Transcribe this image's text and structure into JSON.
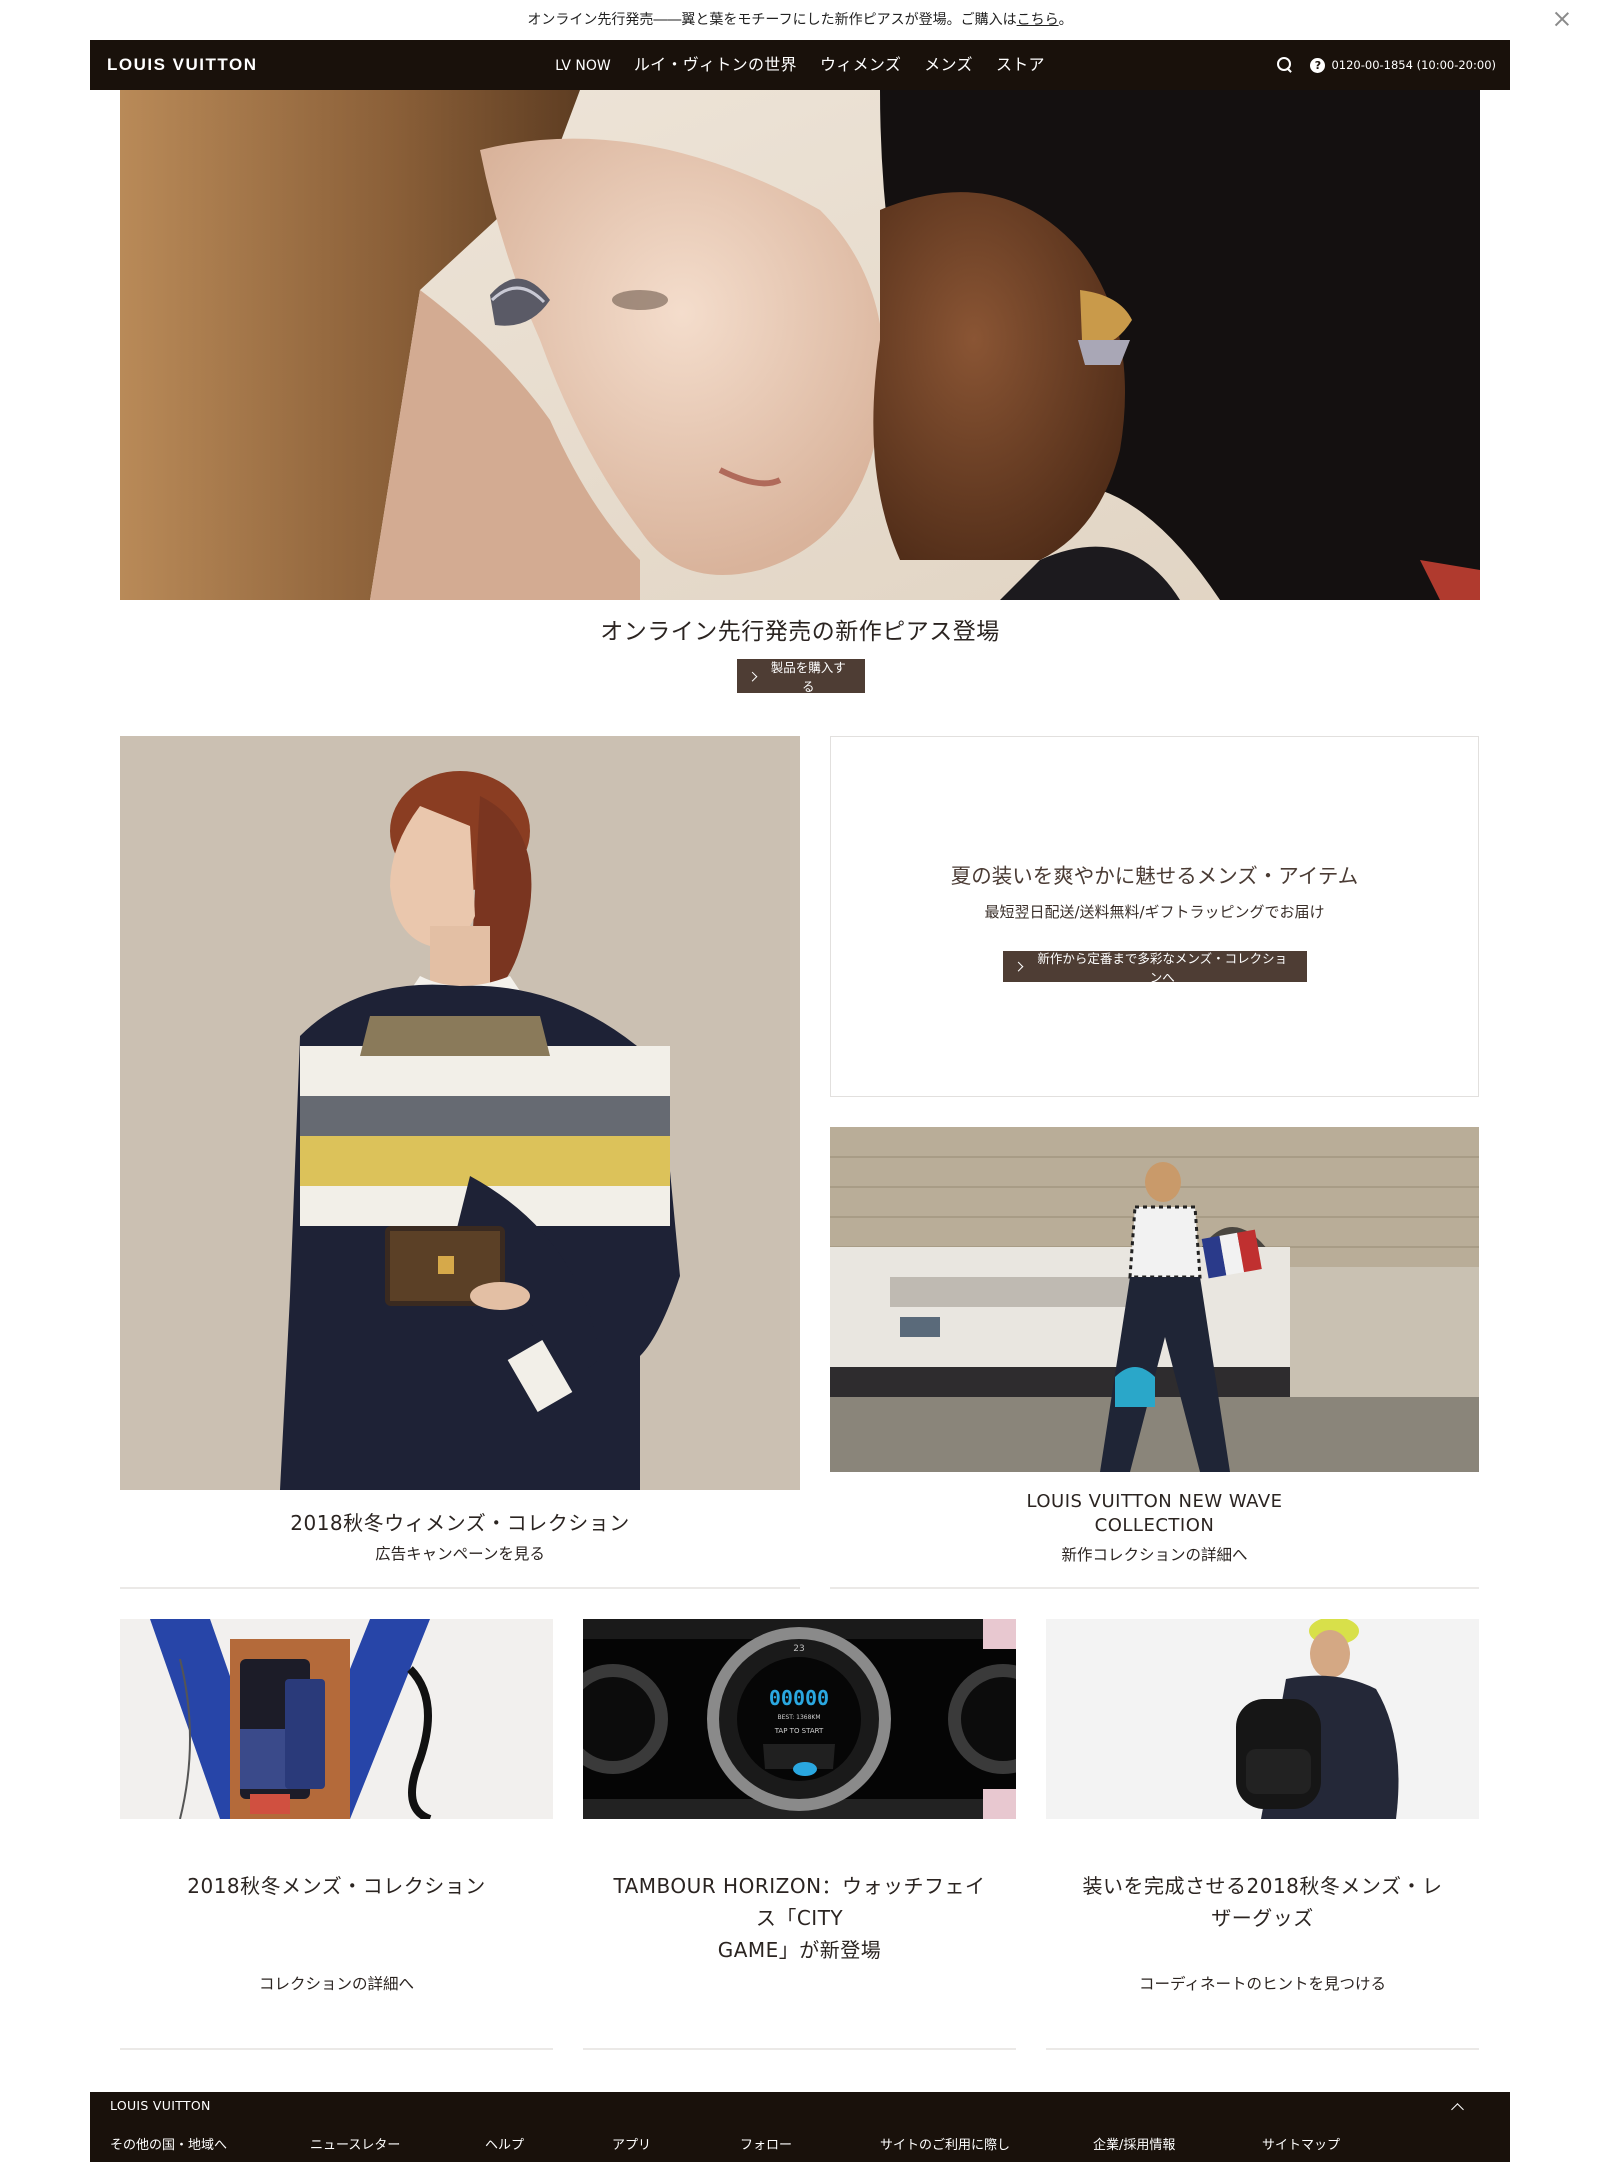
{
  "announcement": {
    "text": "オンライン先行発売――翼と葉をモチーフにした新作ピアスが登場。ご購入は",
    "link": "こちら",
    "end": "。"
  },
  "header": {
    "logo": "LOUIS VUITTON",
    "nav": [
      "LV NOW",
      "ルイ・ヴィトンの世界",
      "ウィメンズ",
      "メンズ",
      "ストア"
    ],
    "phone": "0120-00-1854 (10:00-20:00)"
  },
  "hero": {
    "title": "オンライン先行発売の新作ピアス登場",
    "button": "製品を購入する"
  },
  "women_card": {
    "title": "2018秋冬ウィメンズ・コレクション",
    "link": "広告キャンペーンを見る"
  },
  "promo": {
    "title": "夏の装いを爽やかに魅せるメンズ・アイテム",
    "subtitle": "最短翌日配送/送料無料/ギフトラッピングでお届け",
    "button": "新作から定番まで多彩なメンズ・コレクションへ"
  },
  "newwave_card": {
    "title_line1": "LOUIS VUITTON NEW WAVE",
    "title_line2": "COLLECTION",
    "link": "新作コレクションの詳細へ"
  },
  "small_cards": [
    {
      "title_line1": "2018秋冬メンズ・コレクション",
      "title_line2": "",
      "title_line3": "",
      "link": "コレクションの詳細へ"
    },
    {
      "title_line1": "TAMBOUR HORIZON：ウォッチフェイ",
      "title_line2": "ス「CITY",
      "title_line3": "GAME」が新登場",
      "link": ""
    },
    {
      "title_line1": "装いを完成させる2018秋冬メンズ・レ",
      "title_line2": "ザーグッズ",
      "title_line3": "",
      "link": "コーディネートのヒントを見つける"
    }
  ],
  "watch_display": {
    "score": "00000",
    "best": "BEST: 1368KM",
    "prompt": "TAP TO START",
    "ring_number": "23"
  },
  "footer": {
    "logo": "LOUIS VUITTON",
    "links": [
      "その他の国・地域へ",
      "ニュースレター",
      "ヘルプ",
      "アプリ",
      "フォロー",
      "サイトのご利用に際し",
      "企業/採用情報",
      "サイトマップ"
    ]
  },
  "colors": {
    "header_bg": "#19110b",
    "button_bg": "#4e3d34",
    "text": "#2b2421"
  }
}
